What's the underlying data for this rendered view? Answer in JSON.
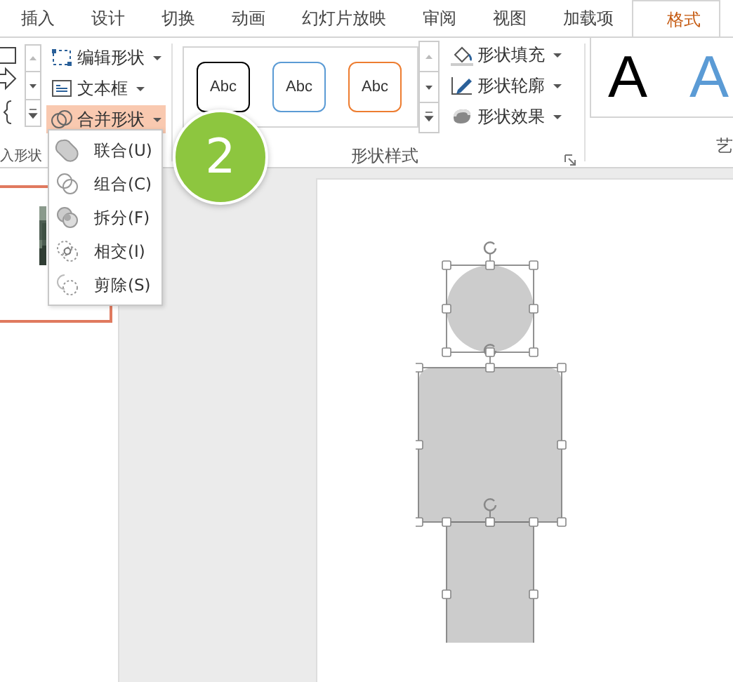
{
  "tabs": [
    {
      "label": "插入",
      "selected": false
    },
    {
      "label": "设计",
      "selected": false
    },
    {
      "label": "切换",
      "selected": false
    },
    {
      "label": "动画",
      "selected": false
    },
    {
      "label": "幻灯片放映",
      "selected": false
    },
    {
      "label": "审阅",
      "selected": false
    },
    {
      "label": "视图",
      "selected": false
    },
    {
      "label": "加载项",
      "selected": false
    },
    {
      "label": "格式",
      "selected": true
    }
  ],
  "insert_shapes": {
    "label": "入形状",
    "commands": [
      {
        "label": "编辑形状",
        "kind": "edit",
        "expanded": false
      },
      {
        "label": "文本框",
        "kind": "textbox",
        "expanded": false
      },
      {
        "label": "合并形状",
        "kind": "merge",
        "expanded": true
      }
    ]
  },
  "shape_styles": {
    "label": "形状样式",
    "swatches": [
      {
        "label": "Abc",
        "color": "#000000"
      },
      {
        "label": "Abc",
        "color": "#5b9bd5"
      },
      {
        "label": "Abc",
        "color": "#ed7d31"
      }
    ],
    "commands": [
      {
        "label": "形状填充",
        "kind": "fill"
      },
      {
        "label": "形状轮廓",
        "kind": "outline"
      },
      {
        "label": "形状效果",
        "kind": "effects"
      }
    ]
  },
  "wordart": {
    "label": "艺",
    "samples": [
      {
        "label": "A",
        "color": "#000000"
      },
      {
        "label": "A",
        "color": "#5b9bd5"
      }
    ]
  },
  "merge_menu": [
    {
      "label": "联合(U)",
      "kind": "union"
    },
    {
      "label": "组合(C)",
      "kind": "combine"
    },
    {
      "label": "拆分(F)",
      "kind": "fragment"
    },
    {
      "label": "相交(I)",
      "kind": "intersect"
    },
    {
      "label": "剪除(S)",
      "kind": "subtract"
    }
  ],
  "step_badge": "2"
}
